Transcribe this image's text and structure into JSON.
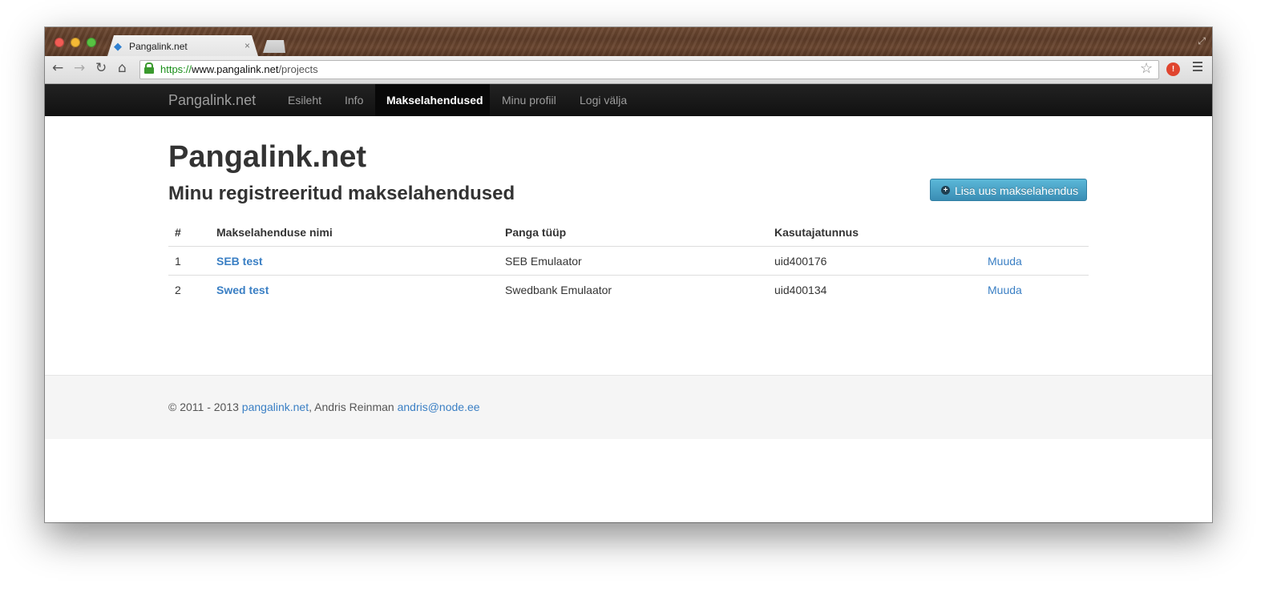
{
  "browser": {
    "tab_title": "Pangalink.net",
    "tab_close": "×",
    "url_scheme": "https://",
    "url_host": "www.pangalink.net",
    "url_path": "/projects",
    "icons": [
      "back-icon",
      "forward-icon",
      "reload-icon",
      "home-icon",
      "lock-icon",
      "star-icon",
      "extension-icon",
      "menu-icon"
    ]
  },
  "navbar": {
    "brand": "Pangalink.net",
    "items": [
      {
        "label": "Esileht"
      },
      {
        "label": "Info"
      },
      {
        "label": "Makselahendused",
        "active": true
      },
      {
        "label": "Minu profiil"
      },
      {
        "label": "Logi välja"
      }
    ]
  },
  "main": {
    "title": "Pangalink.net",
    "subtitle": "Minu registreeritud makselahendused",
    "add_button": "Lisa uus makselahendus",
    "table": {
      "headers": [
        "#",
        "Makselahenduse nimi",
        "Panga tüüp",
        "Kasutajatunnus",
        ""
      ],
      "rows": [
        {
          "num": "1",
          "name": "SEB test",
          "bank_type": "SEB Emulaator",
          "user_id": "uid400176",
          "action": "Muuda"
        },
        {
          "num": "2",
          "name": "Swed test",
          "bank_type": "Swedbank Emulaator",
          "user_id": "uid400134",
          "action": "Muuda"
        }
      ]
    }
  },
  "footer": {
    "copyright": "© 2011 - 2013 ",
    "site_link": "pangalink.net",
    "author": ", Andris Reinman ",
    "email": "andris@node.ee"
  },
  "colors": {
    "link": "#3a7fc4",
    "navbar": "#111111",
    "button": "#49a3c9"
  }
}
